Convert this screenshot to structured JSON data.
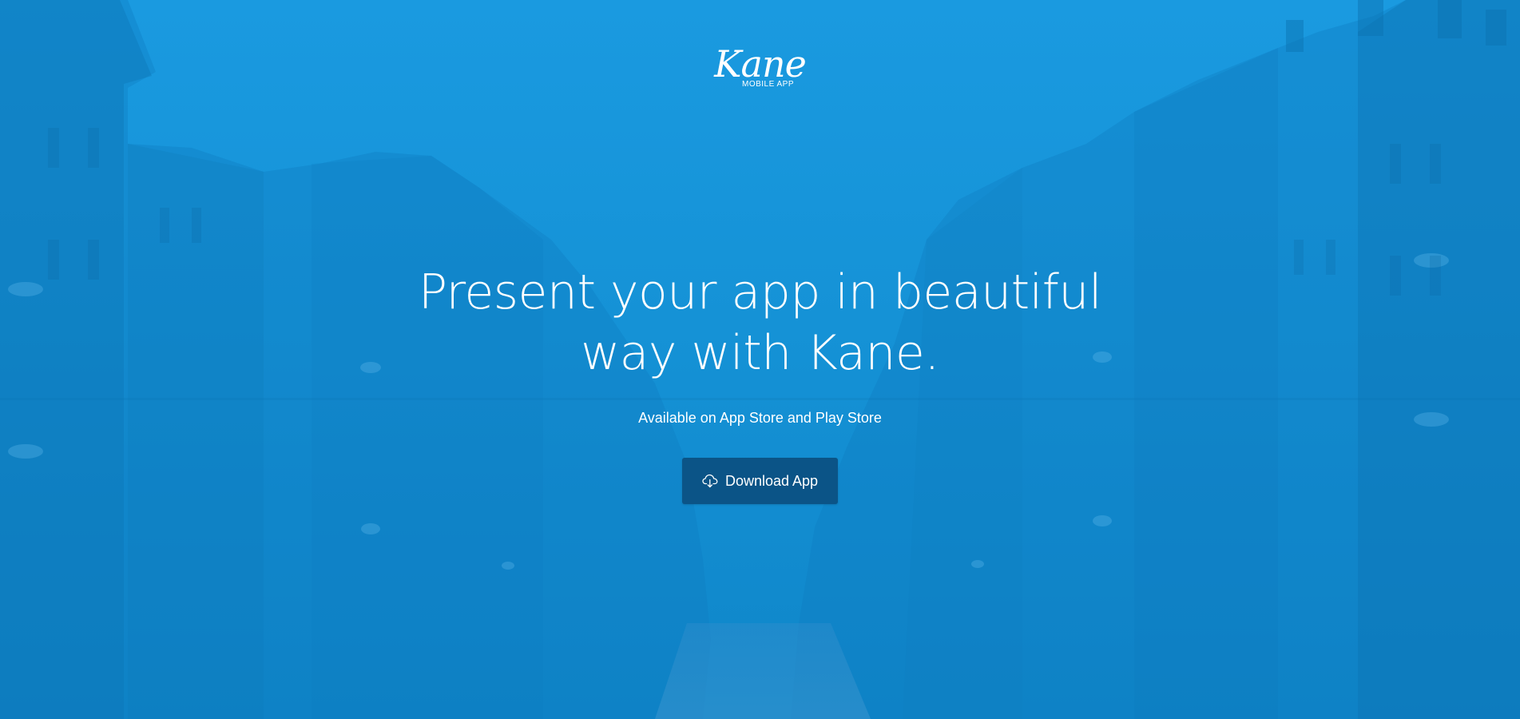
{
  "brand": {
    "name": "Kane",
    "tagline": "MOBILE APP"
  },
  "hero": {
    "headline_line1": "Present your app in beautiful",
    "headline_line2": "way with Kane.",
    "subtitle": "Available on App Store and Play Store",
    "download_label": "Download App",
    "download_icon": "cloud-download-icon"
  },
  "colors": {
    "background": "#1796d9",
    "button": "#0b5487",
    "text": "#ffffff"
  }
}
